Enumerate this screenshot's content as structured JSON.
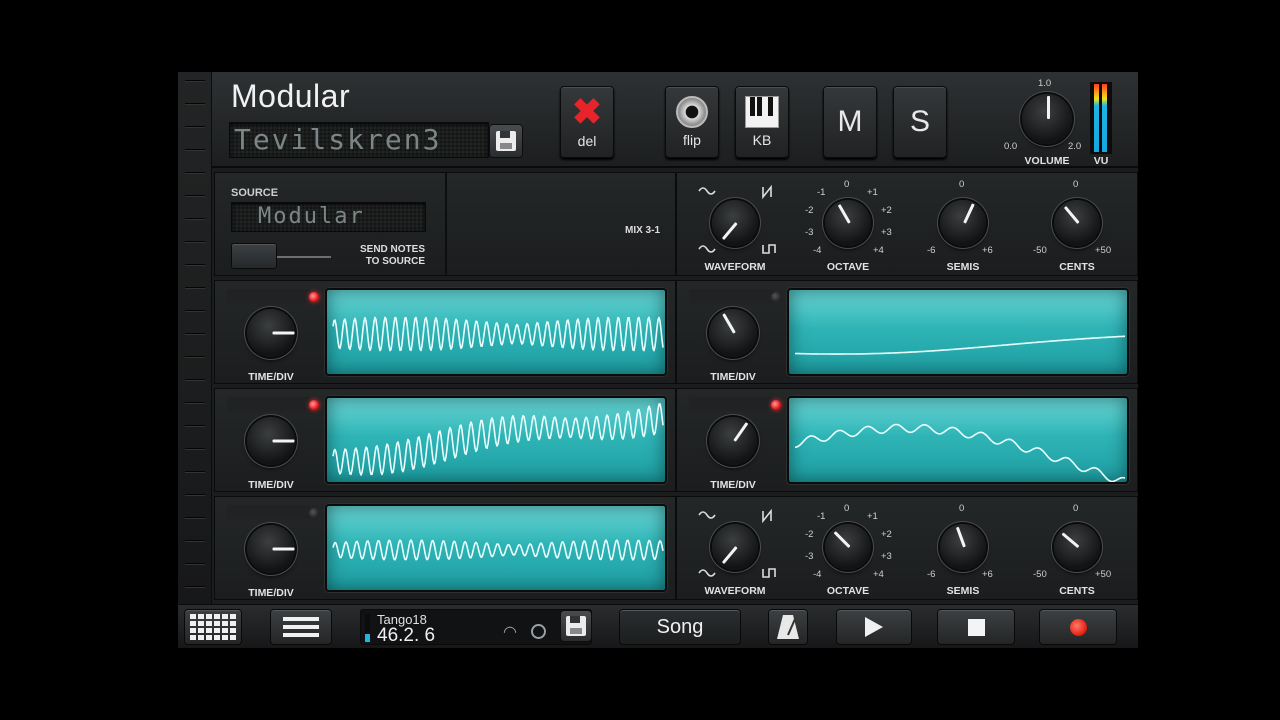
{
  "header": {
    "title": "Modular",
    "preset_name": "Tevilskren3",
    "buttons": {
      "del": "del",
      "flip": "flip",
      "kb": "KB",
      "mute": "M",
      "solo": "S"
    },
    "volume": {
      "label": "VOLUME",
      "min": "0.0",
      "max": "2.0",
      "top": "1.0",
      "value": 1.0
    },
    "vu_label": "VU"
  },
  "source": {
    "label": "SOURCE",
    "value": "Modular",
    "send_notes": "SEND NOTES",
    "to_source": "TO SOURCE",
    "mix": "MIX 3-1"
  },
  "osc_controls": {
    "waveform": "WAVEFORM",
    "octave": "OCTAVE",
    "semis": "SEMIS",
    "cents": "CENTS",
    "octave_ticks": {
      "t0": "0",
      "m1": "-1",
      "p1": "+1",
      "m2": "-2",
      "p2": "+2",
      "m3": "-3",
      "p3": "+3",
      "m4": "-4",
      "p4": "+4"
    },
    "semis_ticks": {
      "t0": "0",
      "min": "-6",
      "max": "+6"
    },
    "cents_ticks": {
      "t0": "0",
      "min": "-50",
      "max": "+50"
    }
  },
  "scopes": {
    "time_div": "TIME/DIV"
  },
  "footer": {
    "song_name": "Tango18",
    "position": "46.2. 6",
    "song_button": "Song"
  },
  "colors": {
    "accent_teal": "#2fb4b6",
    "led_red": "#e5161c",
    "record_red": "#e62a1c",
    "vu_blue": "#14a8e0"
  }
}
